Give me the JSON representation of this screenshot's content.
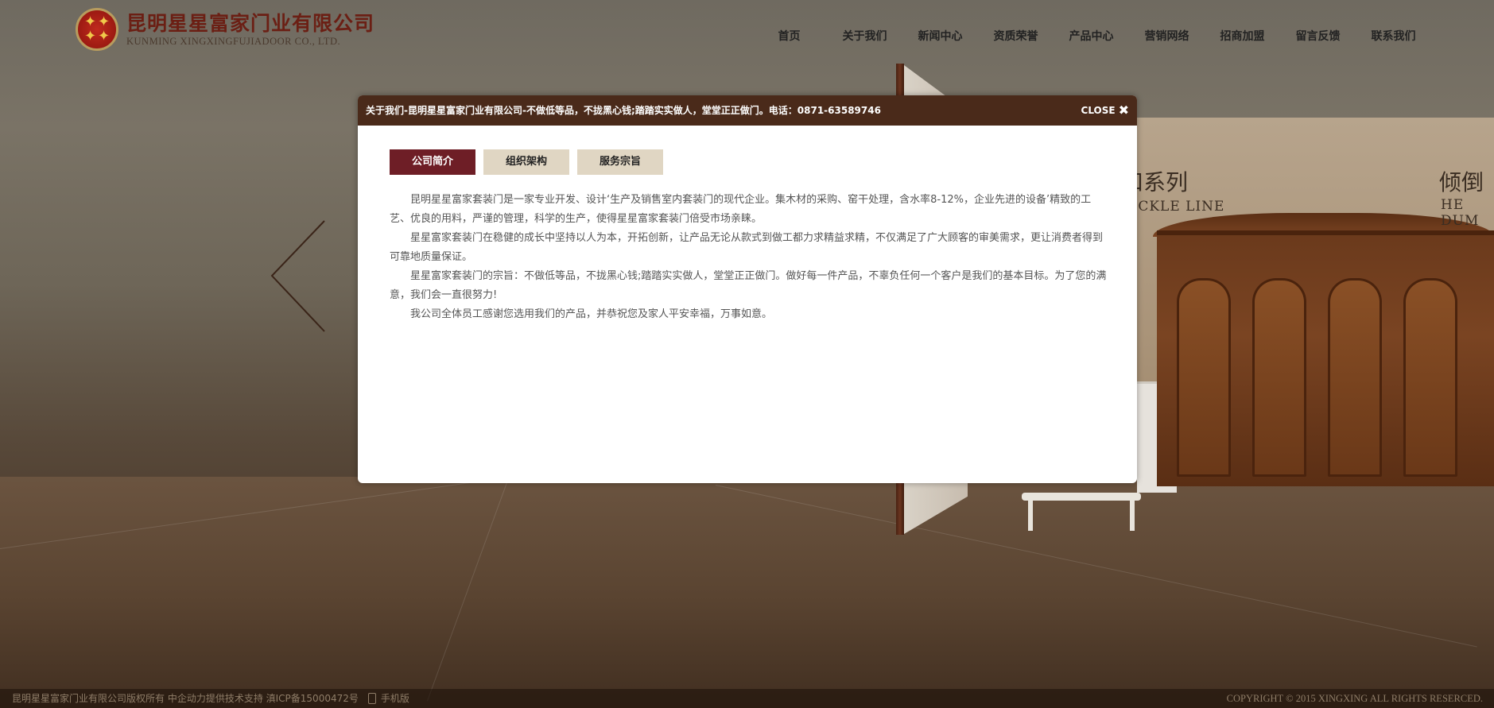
{
  "header": {
    "logo_cn": "昆明星星富家门业有限公司",
    "logo_en": "KUNMING XINGXINGFUJIADOOR CO., LTD.",
    "nav": [
      {
        "label": "首页"
      },
      {
        "label": "关于我们"
      },
      {
        "label": "新闻中心"
      },
      {
        "label": "资质荣誉"
      },
      {
        "label": "产品中心"
      },
      {
        "label": "营销网络"
      },
      {
        "label": "招商加盟"
      },
      {
        "label": "留言反馈"
      },
      {
        "label": "联系我们"
      }
    ]
  },
  "background": {
    "series_cn": "扣系列",
    "series_en": "UCKLE LINE",
    "series2_cn": "倾倒",
    "series2_en": "HE DUM"
  },
  "modal": {
    "title": "关于我们-昆明星星富家门业有限公司-不做低等品，不拢黑心钱;踏踏实实做人，堂堂正正做门。电话：0871-63589746",
    "close_label": "CLOSE",
    "tabs": [
      {
        "label": "公司简介",
        "active": true
      },
      {
        "label": "组织架构",
        "active": false
      },
      {
        "label": "服务宗旨",
        "active": false
      }
    ],
    "paragraphs": [
      "昆明星星富家套装门是一家专业开发、设计‘生产及销售室内套装门的现代企业。集木材的采购、窑干处理，含水率8-12%，企业先进的设备’精致的工艺、优良的用料，严谨的管理，科学的生产，使得星星富家套装门倍受市场亲睐。",
      "星星富家套装门在稳健的成长中坚持以人为本，开拓创新，让产品无论从款式到做工都力求精益求精，不仅满足了广大顾客的审美需求，更让消费者得到可靠地质量保证。",
      "星星富家套装门的宗旨：不做低等品，不拢黑心钱;踏踏实实做人，堂堂正正做门。做好每一件产品，不辜负任何一个客户是我们的基本目标。为了您的满意，我们会一直很努力!",
      "我公司全体员工感谢您选用我们的产品，并恭祝您及家人平安幸福，万事如意。"
    ]
  },
  "footer": {
    "left_text": "昆明星星富家门业有限公司版权所有 中企动力提供技术支持 滇ICP备15000472号",
    "mobile_label": "手机版",
    "copyright": "COPYRIGHT © 2015 XINGXING ALL RIGHTS RESERCED."
  },
  "colors": {
    "modal_header": "#4a2a1a",
    "tab_active": "#6e1e26",
    "tab_inactive": "#e0d6c3",
    "logo_text": "#6b1f14"
  }
}
